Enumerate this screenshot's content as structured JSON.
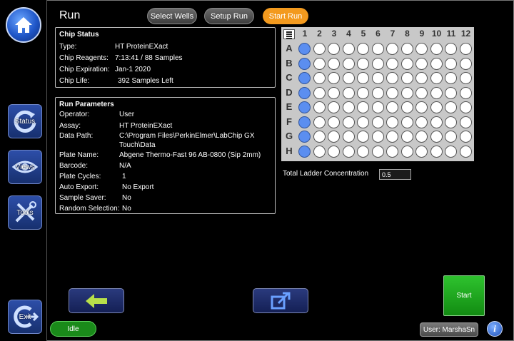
{
  "header": {
    "title": "Run"
  },
  "tabs": {
    "select_wells": "Select Wells",
    "setup_run": "Setup Run",
    "start_run": "Start Run"
  },
  "sidebar": {
    "status": "Status",
    "views": "Views",
    "tools": "Tools",
    "exit": "Exit"
  },
  "chip_status": {
    "heading": "Chip Status",
    "rows": [
      {
        "label": "Type:",
        "value": "HT ProteinEXact"
      },
      {
        "label": "Chip Reagents:",
        "value": "7:13:41 / 88 Samples"
      },
      {
        "label": "Chip Expiration:",
        "value": "Jan-1 2020"
      },
      {
        "label": "Chip Life:",
        "value": "392 Samples Left"
      }
    ]
  },
  "run_parameters": {
    "heading": "Run Parameters",
    "rows": [
      {
        "label": "Operator:",
        "value": "User"
      },
      {
        "label": "Assay:",
        "value": "HT ProteinEXact"
      },
      {
        "label": "Data Path:",
        "value": "C:\\Program Files\\PerkinElmer\\LabChip GX",
        "value2": "Touch\\Data"
      },
      {
        "label": "Plate Name:",
        "value": "Abgene Thermo-Fast 96 AB-0800 (Sip 2mm)"
      },
      {
        "label": "Barcode:",
        "value": "N/A"
      },
      {
        "label": "Plate Cycles:",
        "value": "1"
      },
      {
        "label": "Auto Export:",
        "value": "No Export"
      },
      {
        "label": "Sample Saver:",
        "value": "No"
      },
      {
        "label": "Random Selection:",
        "value": "No"
      }
    ]
  },
  "plate": {
    "columns": [
      "1",
      "2",
      "3",
      "4",
      "5",
      "6",
      "7",
      "8",
      "9",
      "10",
      "11",
      "12"
    ],
    "rows": [
      "A",
      "B",
      "C",
      "D",
      "E",
      "F",
      "G",
      "H"
    ],
    "selected_column": "1",
    "selected_color": "#5b8ef0"
  },
  "ladder": {
    "label": "Total Ladder Concentration",
    "value": "0.5"
  },
  "actions": {
    "start": "Start"
  },
  "status_bar": {
    "state": "Idle",
    "user": "User: MarshaSn",
    "info": "i"
  },
  "colors": {
    "accent_orange": "#f39a1e",
    "start_green": "#22a822",
    "idle_green": "#1a8a1a"
  }
}
